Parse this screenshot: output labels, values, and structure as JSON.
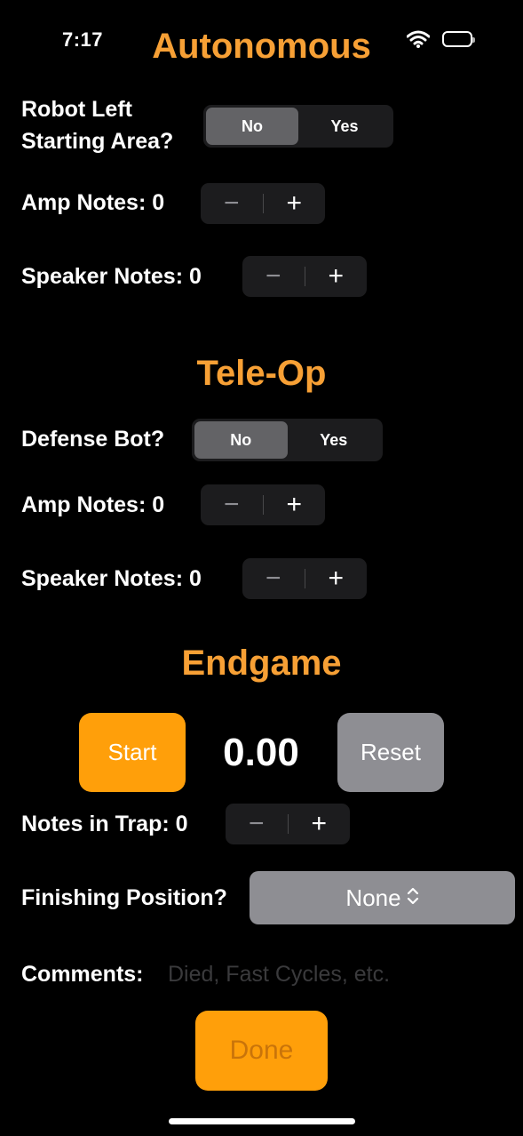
{
  "status_bar": {
    "time": "7:17",
    "icons": [
      "wifi-icon",
      "battery-icon"
    ]
  },
  "autonomous": {
    "title": "Autonomous",
    "left_start": {
      "label_line1": "Robot Left",
      "label_line2": "Starting Area?",
      "options": [
        "No",
        "Yes"
      ],
      "selected": "No"
    },
    "amp": {
      "label": "Amp Notes: 0",
      "minus": "−",
      "plus": "+"
    },
    "speaker": {
      "label": "Speaker Notes: 0",
      "minus": "−",
      "plus": "+"
    }
  },
  "teleop": {
    "title": "Tele-Op",
    "defense": {
      "label": "Defense Bot?",
      "options": [
        "No",
        "Yes"
      ],
      "selected": "No"
    },
    "amp": {
      "label": "Amp Notes: 0",
      "minus": "−",
      "plus": "+"
    },
    "speaker": {
      "label": "Speaker Notes: 0",
      "minus": "−",
      "plus": "+"
    }
  },
  "endgame": {
    "title": "Endgame",
    "start_label": "Start",
    "timer": "0.00",
    "reset_label": "Reset",
    "trap": {
      "label": "Notes in Trap: 0",
      "minus": "−",
      "plus": "+"
    },
    "finishing": {
      "label": "Finishing Position?",
      "value": "None"
    }
  },
  "comments": {
    "label": "Comments:",
    "placeholder": "Died, Fast Cycles, etc.",
    "value": ""
  },
  "done_label": "Done",
  "colors": {
    "accent": "#f7a035",
    "button_orange": "#ff9f0a",
    "gray_button": "#8e8e93",
    "control_bg": "#1c1c1e",
    "segment_selected": "#636366"
  }
}
